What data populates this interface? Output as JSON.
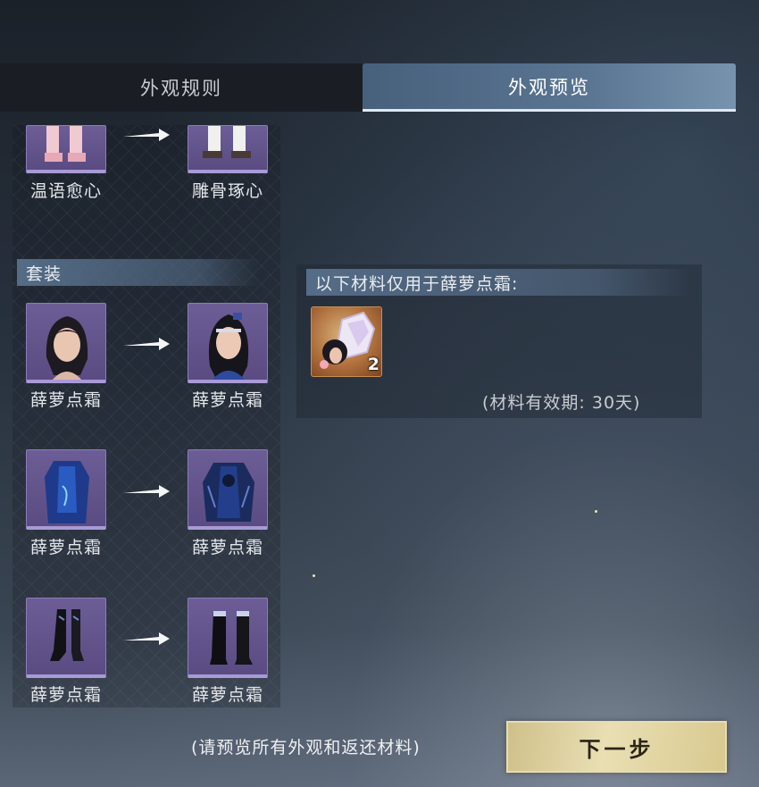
{
  "tabs": {
    "rules": "外观规则",
    "preview": "外观预览"
  },
  "top_pair": {
    "from_label": "温语愈心",
    "to_label": "雕骨琢心",
    "icon": "boots-icon"
  },
  "suit": {
    "header": "套装",
    "rows": [
      {
        "from_label": "薛萝点霜",
        "to_label": "薛萝点霜",
        "icon": "portrait-icon"
      },
      {
        "from_label": "薛萝点霜",
        "to_label": "薛萝点霜",
        "icon": "robe-icon"
      },
      {
        "from_label": "薛萝点霜",
        "to_label": "薛萝点霜",
        "icon": "boots-icon"
      }
    ]
  },
  "materials": {
    "header": "以下材料仅用于薛萝点霜:",
    "item_count": "2",
    "validity": "(材料有效期: 30天)"
  },
  "footer": {
    "hint": "(请预览所有外观和返还材料)",
    "next_button": "下一步"
  },
  "colors": {
    "tab_active": "#5a7592",
    "slot_purple": "#6c5d96",
    "button_gold": "#e9dfb3"
  }
}
